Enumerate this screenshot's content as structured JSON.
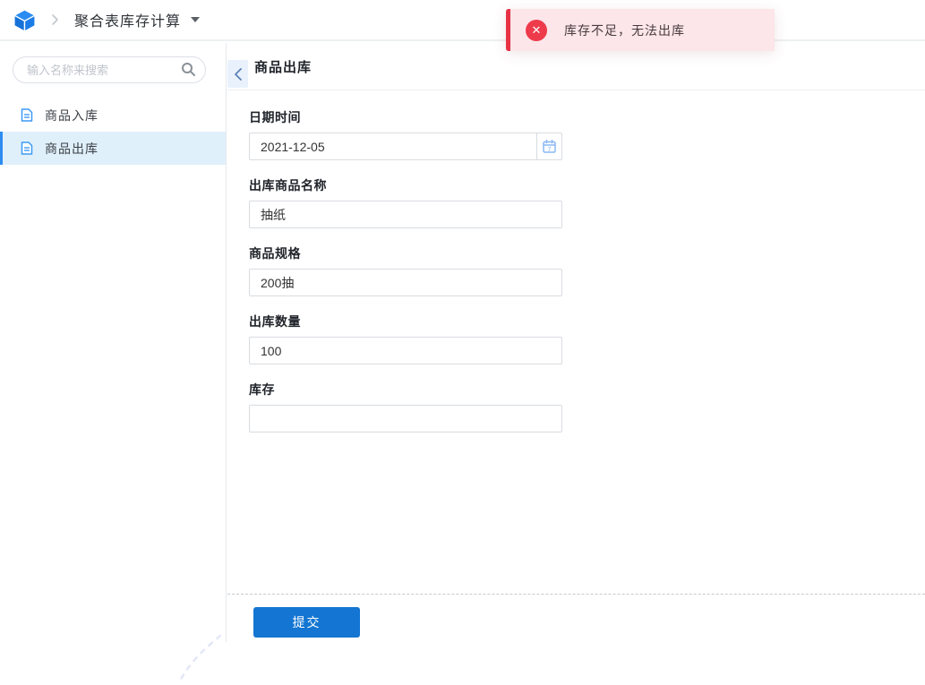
{
  "colors": {
    "primary": "#1476d2",
    "selected_item_bg": "#e0f0fb",
    "selected_item_bar": "#2d8cf0",
    "toast_bg": "#fce6e9",
    "toast_accent": "#e73246",
    "toast_icon_bg": "#ed3b4c"
  },
  "icons": {
    "logo": "blue-cube",
    "breadcrumb_separator": "chevron-right",
    "breadcrumb_caret": "caret-down",
    "search": "magnifier",
    "menu_item": "document",
    "back": "chevron-left",
    "date_picker": "calendar",
    "calendar_day": "7",
    "error_glyph": "✕"
  },
  "header": {
    "breadcrumb_title": "聚合表库存计算"
  },
  "toast": {
    "message": "库存不足，无法出库"
  },
  "sidebar": {
    "search_placeholder": "输入名称来搜索",
    "items": [
      {
        "label": "商品入库",
        "selected": false
      },
      {
        "label": "商品出库",
        "selected": true
      }
    ]
  },
  "main": {
    "title": "商品出库",
    "form": {
      "fields": [
        {
          "label": "日期时间",
          "value": "2021-12-05",
          "type": "date"
        },
        {
          "label": "出库商品名称",
          "value": "抽纸",
          "type": "text"
        },
        {
          "label": "商品规格",
          "value": "200抽",
          "type": "text"
        },
        {
          "label": "出库数量",
          "value": "100",
          "type": "text"
        },
        {
          "label": "库存",
          "value": "",
          "type": "text"
        }
      ],
      "submit_label": "提交"
    }
  }
}
